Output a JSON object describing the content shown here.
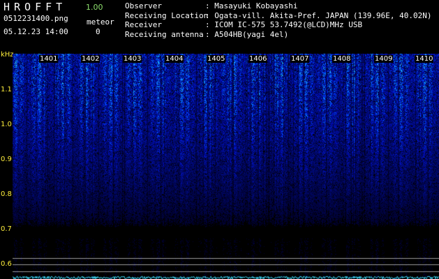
{
  "header": {
    "logo": "HROFFT",
    "version": "1.00",
    "filename": "0512231400.png",
    "meteor_label": "meteor",
    "datetime": "05.12.23 14:00",
    "meteor_count": "0",
    "info": [
      {
        "label": "Observer",
        "value": ": Masayuki Kobayashi"
      },
      {
        "label": "Receiving Location",
        "value": ": Ogata-vill. Akita-Pref. JAPAN (139.96E, 40.02N)"
      },
      {
        "label": "Receiver",
        "value": ": ICOM IC-575 53.7492(@LCD)MHz USB"
      },
      {
        "label": "Receiving antenna",
        "value": ": A504HB(yagi 4el)"
      }
    ]
  },
  "yaxis": {
    "unit": "kHz",
    "ticks": [
      "1.1",
      "1.0",
      "0.9",
      "0.8",
      "0.7",
      "0.6"
    ]
  },
  "xaxis": {
    "ticks": [
      "1401",
      "1402",
      "1403",
      "1404",
      "1405",
      "1406",
      "1407",
      "1408",
      "1409",
      "1410"
    ]
  },
  "colors": {
    "background": "#000000",
    "signal_high": "#3fe0ff",
    "signal_mid": "#1a3fd8",
    "tick_label": "#ffef3c",
    "version": "#8ee06e"
  }
}
